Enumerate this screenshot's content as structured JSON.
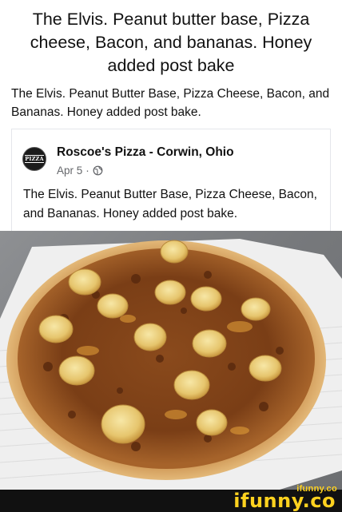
{
  "meme": {
    "title": "The Elvis. Peanut butter base, Pizza cheese, Bacon, and bananas. Honey added post bake",
    "caption": "The Elvis. Peanut Butter Base, Pizza Cheese, Bacon, and Bananas. Honey added post bake."
  },
  "post": {
    "avatar_text": "PIZZA",
    "page_name": "Roscoe's Pizza - Corwin, Ohio",
    "date": "Apr 5",
    "separator": "·",
    "privacy_icon": "globe-icon",
    "text": "The Elvis. Peanut Butter Base, Pizza Cheese, Bacon, and Bananas. Honey added post bake."
  },
  "photo": {
    "subject": "pizza-photo"
  },
  "watermark": {
    "small": "ifunny.co",
    "big": "ifunny.co",
    "color": "#ffd21f"
  }
}
